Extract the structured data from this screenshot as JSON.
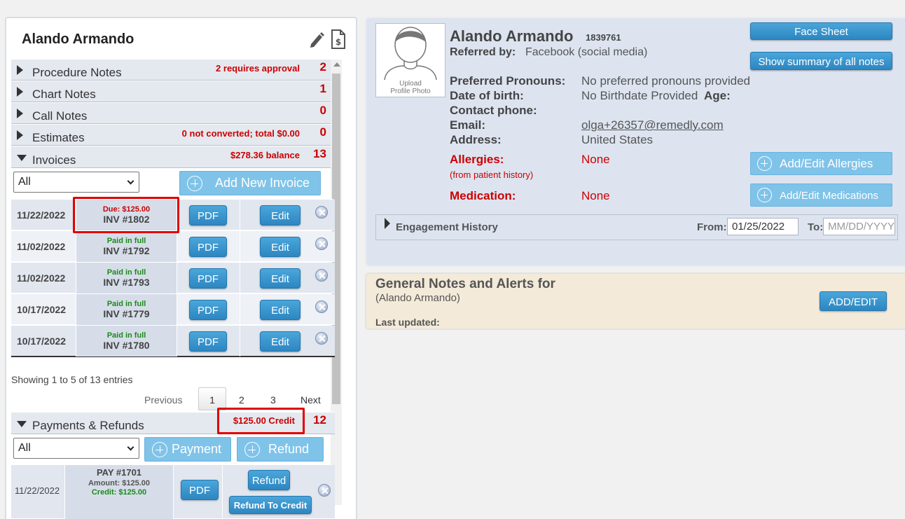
{
  "patient": {
    "name": "Alando Armando",
    "id": "1839761"
  },
  "left_panel": {
    "title": "Alando Armando",
    "icons": [
      "pencil-icon",
      "billing-statement-icon"
    ],
    "sections": [
      {
        "label": "Procedure Notes",
        "info": "2 requires approval",
        "count": "2",
        "expanded": false
      },
      {
        "label": "Chart Notes",
        "info": "",
        "count": "1",
        "expanded": false
      },
      {
        "label": "Call Notes",
        "info": "",
        "count": "0",
        "expanded": false
      },
      {
        "label": "Estimates",
        "info": "0 not converted; total $0.00",
        "count": "0",
        "expanded": false
      },
      {
        "label": "Invoices",
        "info": "$278.36 balance",
        "count": "13",
        "expanded": true
      }
    ],
    "invoices": {
      "filter_value": "All",
      "add_button": "Add New Invoice",
      "pdf_label": "PDF",
      "edit_label": "Edit",
      "rows": [
        {
          "date": "11/22/2022",
          "status": "Due: $125.00",
          "status_color": "#cc0000",
          "invoice": "INV #1802"
        },
        {
          "date": "11/02/2022",
          "status": "Paid in full",
          "status_color": "#1a8a1a",
          "invoice": "INV #1792"
        },
        {
          "date": "11/02/2022",
          "status": "Paid in full",
          "status_color": "#1a8a1a",
          "invoice": "INV #1793"
        },
        {
          "date": "10/17/2022",
          "status": "Paid in full",
          "status_color": "#1a8a1a",
          "invoice": "INV #1779"
        },
        {
          "date": "10/17/2022",
          "status": "Paid in full",
          "status_color": "#1a8a1a",
          "invoice": "INV #1780"
        }
      ],
      "showing": "Showing 1 to 5 of 13 entries",
      "pagination": {
        "previous": "Previous",
        "pages": [
          "1",
          "2",
          "3"
        ],
        "next": "Next",
        "current": "1"
      }
    },
    "payments": {
      "label": "Payments & Refunds",
      "info": "$125.00 Credit",
      "count": "12",
      "filter_value": "All",
      "payment_button": "Payment",
      "refund_button": "Refund",
      "row": {
        "date": "11/22/2022",
        "pay": "PAY #1701",
        "amount": "Amount: $125.00",
        "credit": "Credit: $125.00",
        "pdf": "PDF",
        "refund": "Refund",
        "refund_to_credit": "Refund To Credit"
      }
    }
  },
  "profile": {
    "name": "Alando Armando",
    "id": "1839761",
    "photo_caption_1": "Upload",
    "photo_caption_2": "Profile Photo",
    "referred_label": "Referred by:",
    "referred_value": "Facebook (social media)",
    "face_sheet": "Face Sheet",
    "show_summary": "Show summary of all notes",
    "pronouns_label": "Preferred Pronouns:",
    "pronouns_value": "No preferred pronouns provided",
    "dob_label": "Date of birth:",
    "dob_value": "No Birthdate Provided",
    "age_label": "Age:",
    "phone_label": "Contact phone:",
    "email_label": "Email:",
    "email_value": "olga+26357@remedly.com",
    "address_label": "Address:",
    "address_value": "United States",
    "allergies_label": "Allergies:",
    "allergies_sub": "(from patient history)",
    "allergies_value": "None",
    "medication_label": "Medication:",
    "medication_value": "None",
    "add_allergies": "Add/Edit Allergies",
    "add_medications": "Add/Edit Medications",
    "engagement": "Engagement History",
    "from_label": "From:",
    "from_value": "01/25/2022",
    "to_label": "To:",
    "to_placeholder": "MM/DD/YYYY"
  },
  "general_notes": {
    "title": "General Notes and Alerts for",
    "subtitle": "(Alando Armando)",
    "last_updated": "Last updated:",
    "add_edit": "ADD/EDIT"
  }
}
